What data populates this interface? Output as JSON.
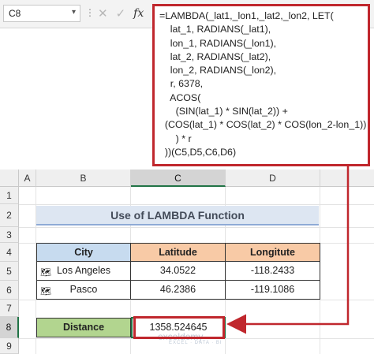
{
  "formula_bar": {
    "name_box": "C8",
    "cancel_icon": "✕",
    "enter_icon": "✓",
    "fx_label": "fx",
    "formula_lines": [
      "=LAMBDA(_lat1,_lon1,_lat2,_lon2, LET(",
      "    lat_1, RADIANS(_lat1),",
      "    lon_1, RADIANS(_lon1),",
      "    lat_2, RADIANS(_lat2),",
      "    lon_2, RADIANS(_lon2),",
      "    r, 6378,",
      "    ACOS(",
      "      (SIN(lat_1) * SIN(lat_2)) +",
      "  (COS(lat_1) * COS(lat_2) * COS(lon_2-lon_1))",
      "      ) * r",
      "  ))(C5,D5,C6,D6)"
    ]
  },
  "sheet": {
    "columns": [
      "A",
      "B",
      "C",
      "D"
    ],
    "active_column": "C",
    "rows": [
      "1",
      "2",
      "3",
      "4",
      "5",
      "6",
      "7",
      "8",
      "9"
    ],
    "active_row": "8",
    "title": "Use of LAMBDA Function",
    "table": {
      "headers": [
        "City",
        "Latitude",
        "Longitute"
      ],
      "rows": [
        {
          "city": "Los Angeles",
          "lat": "34.0522",
          "lon": "-118.2433"
        },
        {
          "city": "Pasco",
          "lat": "46.2386",
          "lon": "-119.1086"
        }
      ]
    },
    "distance_label": "Distance",
    "distance_value": "1358.524645"
  },
  "watermark": {
    "name": "exceldemy",
    "tagline": "EXCEL · DATA · BI"
  },
  "colors": {
    "highlight_red": "#c0272d",
    "excel_green": "#217346"
  }
}
